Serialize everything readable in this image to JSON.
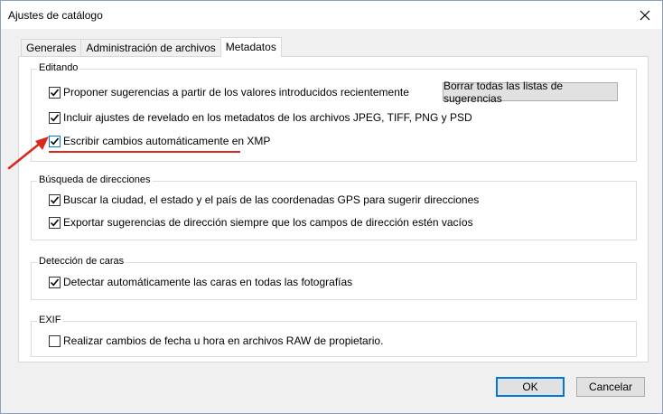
{
  "window": {
    "title": "Ajustes de catálogo",
    "close_icon": "close-icon"
  },
  "tabs": [
    {
      "label": "Generales",
      "active": false
    },
    {
      "label": "Administración de archivos",
      "active": false
    },
    {
      "label": "Metadatos",
      "active": true
    }
  ],
  "sections": {
    "editing": {
      "legend": "Editando",
      "options": [
        {
          "label": "Proponer sugerencias a partir de los valores introducidos recientemente",
          "checked": true
        },
        {
          "label": "Incluir ajustes de revelado en los metadatos de los archivos JPEG, TIFF, PNG y PSD",
          "checked": true
        },
        {
          "label": "Escribir cambios automáticamente en XMP",
          "checked": true
        }
      ],
      "clear_button": "Borrar todas las listas de sugerencias"
    },
    "address": {
      "legend": "Búsqueda de direcciones",
      "options": [
        {
          "label": "Buscar la ciudad, el estado y el país de las coordenadas GPS para sugerir direcciones",
          "checked": true
        },
        {
          "label": "Exportar sugerencias de dirección siempre que los campos de dirección estén vacíos",
          "checked": true
        }
      ]
    },
    "faces": {
      "legend": "Detección de caras",
      "options": [
        {
          "label": "Detectar automáticamente las caras en todas las fotografías",
          "checked": true
        }
      ]
    },
    "exif": {
      "legend": "EXIF",
      "options": [
        {
          "label": "Realizar cambios de fecha u hora en archivos RAW de propietario.",
          "checked": false
        }
      ]
    }
  },
  "footer": {
    "ok": "OK",
    "cancel": "Cancelar"
  },
  "annotation": {
    "arrow_color": "#d9291c",
    "underline_color": "#d9291c"
  }
}
